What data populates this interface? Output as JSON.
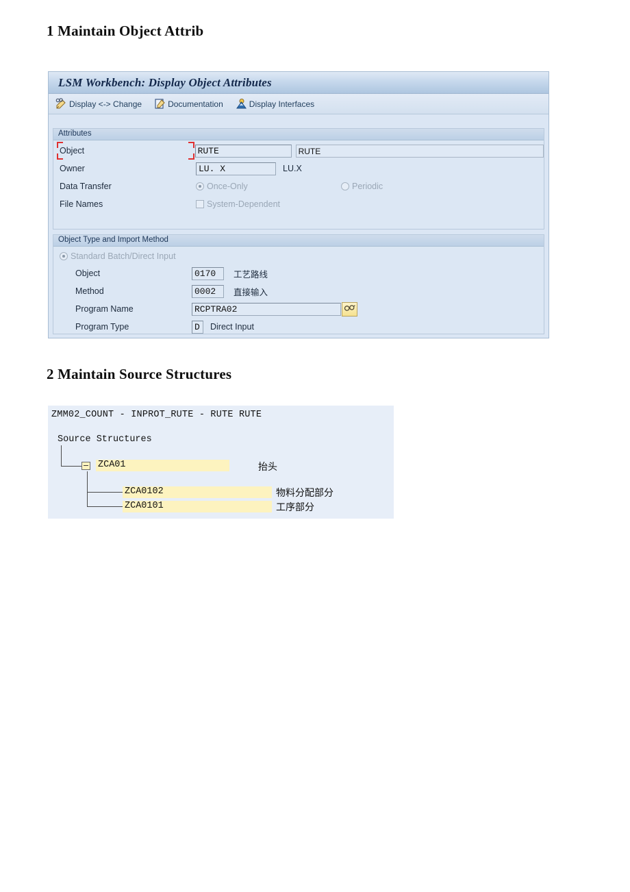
{
  "document": {
    "heading_1": "1 Maintain Object Attrib",
    "heading_2": "2 Maintain Source Structures"
  },
  "sap_window": {
    "title": "LSM Workbench: Display Object Attributes",
    "toolbar": {
      "buttons": [
        {
          "label": "Display <-> Change",
          "icon": "pencil-glasses-icon"
        },
        {
          "label": "Documentation",
          "icon": "document-pencil-icon"
        },
        {
          "label": "Display Interfaces",
          "icon": "person-icon"
        }
      ]
    },
    "attributes_group": {
      "header": "Attributes",
      "object": {
        "label": "Object",
        "value": "RUTE",
        "description": "RUTE"
      },
      "owner": {
        "label": "Owner",
        "value": "LU. X",
        "description": "LU.X"
      },
      "data_transfer": {
        "label": "Data Transfer",
        "option_once": "Once-Only",
        "option_periodic": "Periodic",
        "selected": "Once-Only"
      },
      "file_names": {
        "label": "File Names",
        "option_system_dependent": "System-Dependent",
        "checked": false
      }
    },
    "object_type_group": {
      "header": "Object Type and Import Method",
      "standard_option": "Standard Batch/Direct Input",
      "object": {
        "label": "Object",
        "value": "0170",
        "description": "工艺路线"
      },
      "method": {
        "label": "Method",
        "value": "0002",
        "description": "直接输入"
      },
      "program_name": {
        "label": "Program Name",
        "value": "RCPTRA02",
        "help_icon": "search-help-glasses-icon"
      },
      "program_type": {
        "label": "Program Type",
        "value": "D",
        "description": "Direct Input"
      }
    }
  },
  "source_structures": {
    "header": "ZMM02_COUNT - INPROT_RUTE - RUTE RUTE",
    "root_label": "Source Structures",
    "nodes": [
      {
        "name": "ZCA01",
        "description": "抬头",
        "icon": "collapse-box-icon"
      },
      {
        "name": "ZCA0102",
        "description": "物料分配部分"
      },
      {
        "name": "ZCA0101",
        "description": "工序部分"
      }
    ]
  },
  "colors": {
    "panel_bg": "#dce7f4",
    "titlebar": "#bcd2e8",
    "field_yellow": "#fdf3bf",
    "focus_red": "#e03030"
  }
}
